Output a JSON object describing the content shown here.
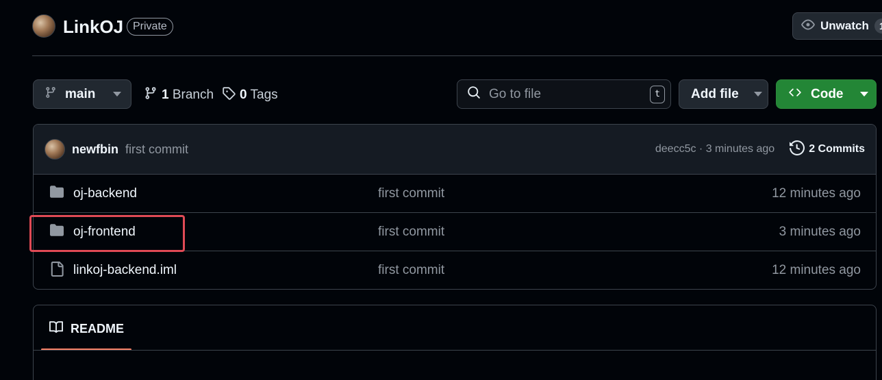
{
  "repo": {
    "name": "LinkOJ",
    "visibility": "Private"
  },
  "watch": {
    "label": "Unwatch",
    "count": "1"
  },
  "toolbar": {
    "branch": "main",
    "branch_count": "1",
    "branch_label": "Branch",
    "tag_count": "0",
    "tag_label": "Tags",
    "search_placeholder": "Go to file",
    "search_shortcut": "t",
    "add_file_label": "Add file",
    "code_label": "Code"
  },
  "latest_commit": {
    "author": "newfbin",
    "message": "first commit",
    "meta": "deecc5c · 3 minutes ago",
    "commits_label": "2 Commits"
  },
  "files": [
    {
      "type": "folder",
      "name": "oj-backend",
      "message": "first commit",
      "time": "12 minutes ago"
    },
    {
      "type": "folder",
      "name": "oj-frontend",
      "message": "first commit",
      "time": "3 minutes ago"
    },
    {
      "type": "file",
      "name": "linkoj-backend.iml",
      "message": "first commit",
      "time": "12 minutes ago"
    }
  ],
  "readme": {
    "tab_label": "README"
  }
}
